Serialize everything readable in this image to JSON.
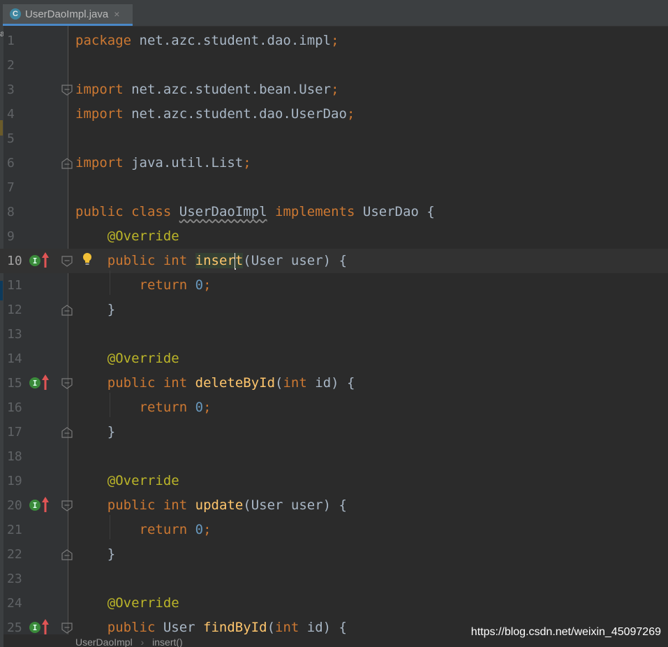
{
  "tab": {
    "icon_letter": "C",
    "filename": "UserDaoImpl.java",
    "close": "×"
  },
  "left_strip": {
    "letter": "a"
  },
  "lines": [
    {
      "num": "1",
      "code": "package net.azc.student.dao.impl;"
    },
    {
      "num": "2",
      "code": ""
    },
    {
      "num": "3",
      "code": "import net.azc.student.bean.User;"
    },
    {
      "num": "4",
      "code": "import net.azc.student.dao.UserDao;"
    },
    {
      "num": "5",
      "code": ""
    },
    {
      "num": "6",
      "code": "import java.util.List;"
    },
    {
      "num": "7",
      "code": ""
    },
    {
      "num": "8",
      "code": "public class UserDaoImpl implements UserDao {"
    },
    {
      "num": "9",
      "code": "    @Override"
    },
    {
      "num": "10",
      "code": "    public int insert(User user) {"
    },
    {
      "num": "11",
      "code": "        return 0;"
    },
    {
      "num": "12",
      "code": "    }"
    },
    {
      "num": "13",
      "code": ""
    },
    {
      "num": "14",
      "code": "    @Override"
    },
    {
      "num": "15",
      "code": "    public int deleteById(int id) {"
    },
    {
      "num": "16",
      "code": "        return 0;"
    },
    {
      "num": "17",
      "code": "    }"
    },
    {
      "num": "18",
      "code": ""
    },
    {
      "num": "19",
      "code": "    @Override"
    },
    {
      "num": "20",
      "code": "    public int update(User user) {"
    },
    {
      "num": "21",
      "code": "        return 0;"
    },
    {
      "num": "22",
      "code": "    }"
    },
    {
      "num": "23",
      "code": ""
    },
    {
      "num": "24",
      "code": "    @Override"
    },
    {
      "num": "25",
      "code": "    public User findById(int id) {"
    }
  ],
  "implements_marker": {
    "letter": "I"
  },
  "breadcrumb": {
    "class_name": "UserDaoImpl",
    "separator": "›",
    "method": "insert()"
  },
  "watermark": "https://blog.csdn.net/weixin_45097269",
  "colors": {
    "background": "#2b2b2b",
    "gutter": "#313335",
    "keyword": "#cc7832",
    "annotation": "#bbb529",
    "function": "#ffc66d",
    "number": "#6897bb",
    "text": "#a9b7c6"
  }
}
